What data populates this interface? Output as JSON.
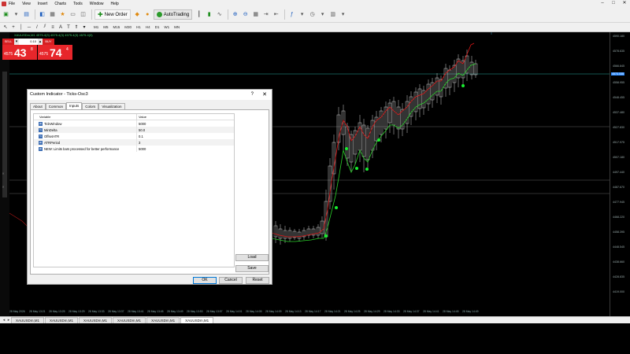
{
  "menu": [
    "File",
    "View",
    "Insert",
    "Charts",
    "Tools",
    "Window",
    "Help"
  ],
  "window_controls": [
    "–",
    "□",
    "✕"
  ],
  "toolbar": {
    "new_order": "New Order",
    "auto_trading": "AutoTrading"
  },
  "timeframes": [
    "M1",
    "M5",
    "M15",
    "M30",
    "H1",
    "H4",
    "D1",
    "W1",
    "MN"
  ],
  "chart": {
    "symbol_text": "XAUUSDm,M1  4575.4(3) 4575.4(3) 4575.4(3) 4575.4(3)",
    "price_labels": [
      "4590.180",
      "4578.635",
      "4566.845",
      "4558.955",
      "4548.455",
      "4537.480",
      "4527.830",
      "4517.975",
      "4507.180",
      "4497.440",
      "4487.670",
      "4477.945",
      "4468.220",
      "4458.395",
      "4448.545",
      "4438.660",
      "4428.835",
      "4419.000"
    ],
    "current_price": "4573.035",
    "time_labels": [
      "28 May 2026",
      "28 May 13:21",
      "28 May 13:25",
      "28 May 13:29",
      "28 May 13:33",
      "28 May 13:37",
      "28 May 13:41",
      "28 May 13:45",
      "28 May 13:49",
      "28 May 13:53",
      "28 May 13:57",
      "28 May 14:01",
      "28 May 14:05",
      "28 May 14:09",
      "28 May 14:13",
      "28 May 14:17",
      "28 May 14:21",
      "28 May 14:25",
      "28 May 14:29",
      "28 May 14:33",
      "28 May 14:37",
      "28 May 14:41",
      "28 May 14:45",
      "28 May 14:49"
    ]
  },
  "one_click": {
    "sell_label": "SELL",
    "buy_label": "BUY",
    "volume": "0.10",
    "minus": "▾",
    "plus": "▴",
    "sell_base": "4575",
    "sell_big": "43",
    "sell_sup": "8",
    "buy_base": "4575",
    "buy_big": "74",
    "buy_sup": "4"
  },
  "chart_tabs": [
    "XAUUSDm,M1",
    "XAUUSDm,M1",
    "XAUUSDm,M1",
    "XAUUSDm,M1",
    "XAUUSDm,M1",
    "XAUUSDm,M1"
  ],
  "dialog": {
    "title": "Custom Indicator - Ticks-Osc3",
    "help": "?",
    "close": "✕",
    "tabs": [
      "About",
      "Common",
      "Inputs",
      "Colors",
      "Visualization"
    ],
    "active_tab": "Inputs",
    "table_header": {
      "variable": "Variable",
      "value": "Value"
    },
    "params": [
      {
        "icon": "ab",
        "name": "TickWindow",
        "value": "5000"
      },
      {
        "icon": "½",
        "name": "MinDelta",
        "value": "50.0"
      },
      {
        "icon": "½",
        "name": "OffsetATR",
        "value": "0.1"
      },
      {
        "icon": "ab",
        "name": "ATRPeriod",
        "value": "3"
      },
      {
        "icon": "ab",
        "name": "NEW: Limits bars processed for better performance",
        "value": "5000"
      }
    ],
    "load_button": "Load",
    "save_button": "Save",
    "ok_button": "OK",
    "cancel_button": "Cancel",
    "reset_button": "Reset"
  }
}
